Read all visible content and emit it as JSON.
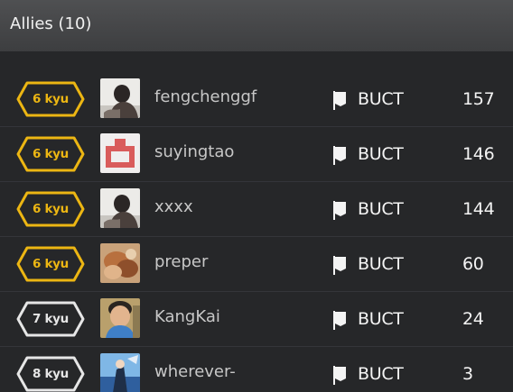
{
  "header": {
    "title": "Allies (10)"
  },
  "colors": {
    "rank_gold": "#ecb613",
    "rank_white": "#e6e6e6",
    "text_primary": "#f4f4f4",
    "text_username": "#c7c7c7",
    "background": "#262729",
    "header_background": "#4a4b4d"
  },
  "rows": [
    {
      "rank": "6 kyu",
      "rank_color": "#ecb613",
      "avatar_icon": "photo-avatar-grayscale",
      "username": "fengchenggf",
      "clan_icon": "flag-icon",
      "clan": "BUCT",
      "score": "157"
    },
    {
      "rank": "6 kyu",
      "rank_color": "#ecb613",
      "avatar_icon": "pixel-avatar-red",
      "username": "suyingtao",
      "clan_icon": "flag-icon",
      "clan": "BUCT",
      "score": "146"
    },
    {
      "rank": "6 kyu",
      "rank_color": "#ecb613",
      "avatar_icon": "photo-avatar-grayscale",
      "username": "xxxx",
      "clan_icon": "flag-icon",
      "clan": "BUCT",
      "score": "144"
    },
    {
      "rank": "6 kyu",
      "rank_color": "#ecb613",
      "avatar_icon": "photo-avatar-warm",
      "username": "preper",
      "clan_icon": "flag-icon",
      "clan": "BUCT",
      "score": "60"
    },
    {
      "rank": "7 kyu",
      "rank_color": "#e6e6e6",
      "avatar_icon": "photo-avatar-child",
      "username": "KangKai",
      "clan_icon": "flag-icon",
      "clan": "BUCT",
      "score": "24"
    },
    {
      "rank": "8 kyu",
      "rank_color": "#e6e6e6",
      "avatar_icon": "photo-avatar-anime",
      "username": "wherever-",
      "clan_icon": "flag-icon",
      "clan": "BUCT",
      "score": "3"
    }
  ]
}
